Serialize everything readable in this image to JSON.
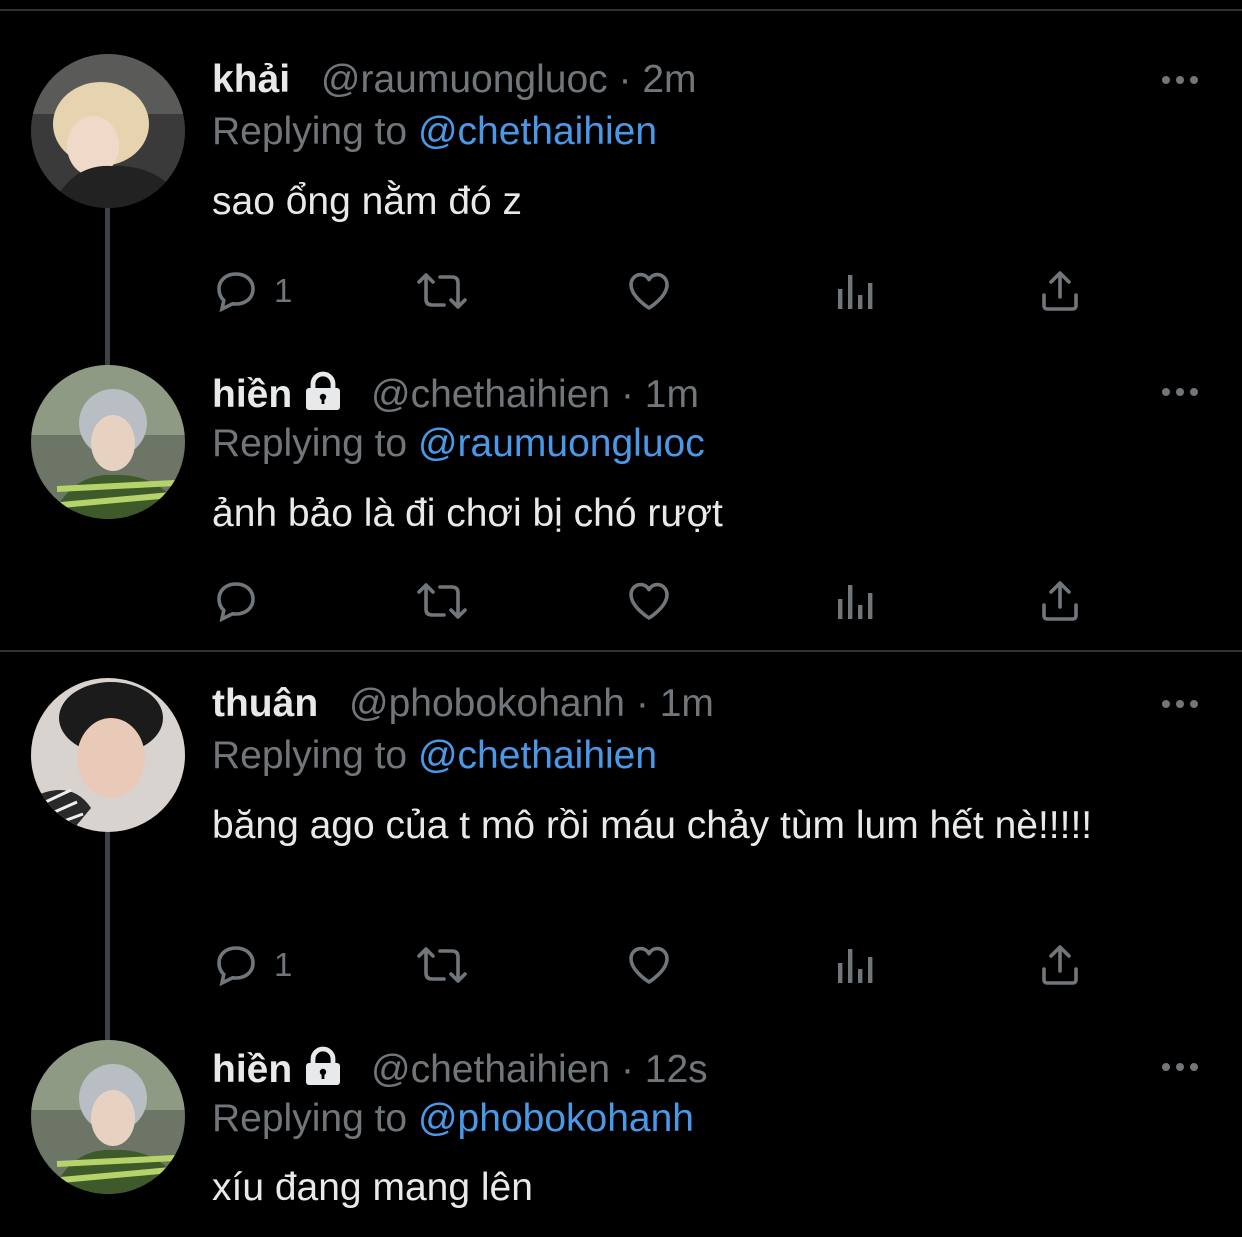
{
  "tweets": [
    {
      "name": "khải",
      "locked": false,
      "handle": "@raumuongluoc",
      "time": "2m",
      "replying_prefix": "Replying to",
      "replying_to": "@chethaihien",
      "text": "sao ổng nằm đó z",
      "reply_count": "1"
    },
    {
      "name": "hiền",
      "locked": true,
      "handle": "@chethaihien",
      "time": "1m",
      "replying_prefix": "Replying to",
      "replying_to": "@raumuongluoc",
      "text": "ảnh bảo là đi chơi bị chó rượt",
      "reply_count": ""
    },
    {
      "name": "thuân",
      "locked": false,
      "handle": "@phobokohanh",
      "time": "1m",
      "replying_prefix": "Replying to",
      "replying_to": "@chethaihien",
      "text": "băng ago của t mô rồi máu chảy tùm lum hết nè!!!!!",
      "reply_count": "1"
    },
    {
      "name": "hiền",
      "locked": true,
      "handle": "@chethaihien",
      "time": "12s",
      "replying_prefix": "Replying to",
      "replying_to": "@phobokohanh",
      "text": "xíu đang mang lên",
      "reply_count": ""
    }
  ],
  "separator": "·",
  "icons": {
    "reply": "reply-icon",
    "retweet": "retweet-icon",
    "like": "heart-icon",
    "analytics": "analytics-icon",
    "share": "share-icon",
    "more": "more-icon",
    "lock": "lock-icon"
  },
  "colors": {
    "background": "#000000",
    "mention": "#4a99e9",
    "secondary_text": "#71767b",
    "primary_text": "#e7e9ea",
    "divider": "#2f3336"
  }
}
